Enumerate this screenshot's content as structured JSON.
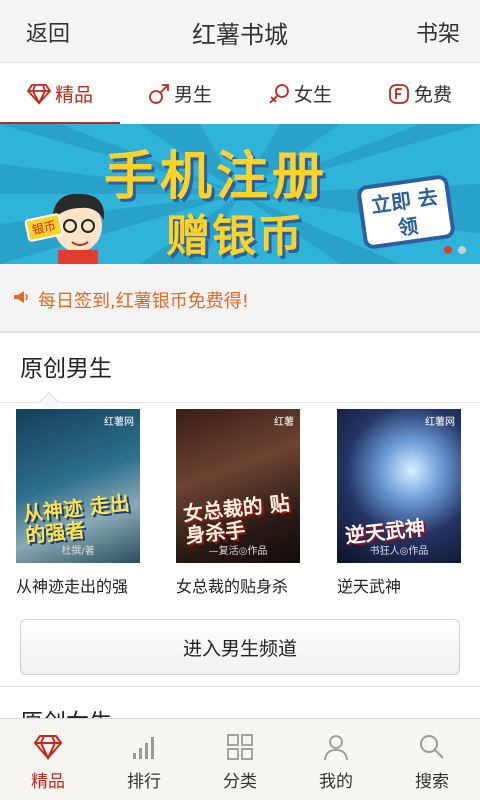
{
  "header": {
    "back_label": "返回",
    "title": "红薯书城",
    "shelf_label": "书架"
  },
  "tabs": [
    {
      "label": "精品",
      "icon": "diamond-icon"
    },
    {
      "label": "男生",
      "icon": "male-icon"
    },
    {
      "label": "女生",
      "icon": "female-icon"
    },
    {
      "label": "免费",
      "icon": "free-icon"
    }
  ],
  "banner": {
    "line1": "手机注册",
    "line2": "赠银币",
    "cta": "立即 去领",
    "coin_tag": "银币",
    "page_count": 2,
    "active_page": 1
  },
  "notice": {
    "text": "每日签到,红薯银币免费得!",
    "color": "#e8671f"
  },
  "section_male": {
    "title": "原创男生",
    "books": [
      {
        "name": "从神迹走出的强",
        "cover_title": "从神迹 走出的强者",
        "cover_author": "杜撰/著",
        "site": "红薯网"
      },
      {
        "name": "女总裁的贴身杀",
        "cover_title": "女总裁的 贴身杀手",
        "cover_author": "—复活◎作品",
        "site": "红薯"
      },
      {
        "name": "逆天武神",
        "cover_title": "逆天武神",
        "cover_author": "书狂人◎作品",
        "site": "红薯网"
      }
    ],
    "enter_button": "进入男生频道"
  },
  "section_female": {
    "title": "原创女生"
  },
  "bottom_nav": [
    {
      "label": "精品",
      "icon": "diamond-icon",
      "active": true
    },
    {
      "label": "排行",
      "icon": "ranking-icon",
      "active": false
    },
    {
      "label": "分类",
      "icon": "category-grid-icon",
      "active": false
    },
    {
      "label": "我的",
      "icon": "user-icon",
      "active": false
    },
    {
      "label": "搜索",
      "icon": "search-icon",
      "active": false
    }
  ],
  "colors": {
    "accent": "#c3271b",
    "banner_bg": "#2fb3d8",
    "banner_text": "#ffd22a"
  }
}
